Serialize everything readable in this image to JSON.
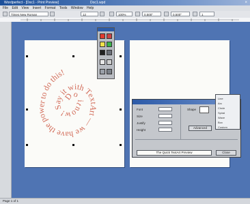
{
  "window": {
    "title": "Wordperfect - [Doc1 - Print Preview]",
    "subtitle": "Doc1.wpd",
    "close_glyph": "×"
  },
  "menubar": {
    "items": [
      "File",
      "Edit",
      "View",
      "Insert",
      "Format",
      "Tools",
      "Window",
      "Help"
    ]
  },
  "toolbar": {
    "font_name": "Times New Roman",
    "font_size": "12",
    "zoom": "100%",
    "field_a": "0.500\"",
    "field_b": "0.500\"",
    "field_c": "1"
  },
  "spiral": {
    "text": "Do it now! Say it with TextArt — we have the power to do this!",
    "color": "#d26b58"
  },
  "palette": {
    "colors": [
      "#e23b2f",
      "#c44",
      "#f0e14a",
      "#3ab34a",
      "#222",
      "#6a6f78"
    ]
  },
  "dialog": {
    "labels": [
      "Font",
      "Size",
      "Justify",
      "Height"
    ],
    "field_values": [
      "",
      "",
      "",
      ""
    ],
    "shape_label": "Shape",
    "option_button": "Advanced",
    "close_button": "Close",
    "preview_text": "The Quick TextArt Preview"
  },
  "dropdown": {
    "items": [
      "Line",
      "Arc",
      "Circle",
      "Spiral",
      "Wave",
      "Box",
      "Custom"
    ]
  },
  "statusbar": {
    "text": "Page 1 of 1"
  }
}
